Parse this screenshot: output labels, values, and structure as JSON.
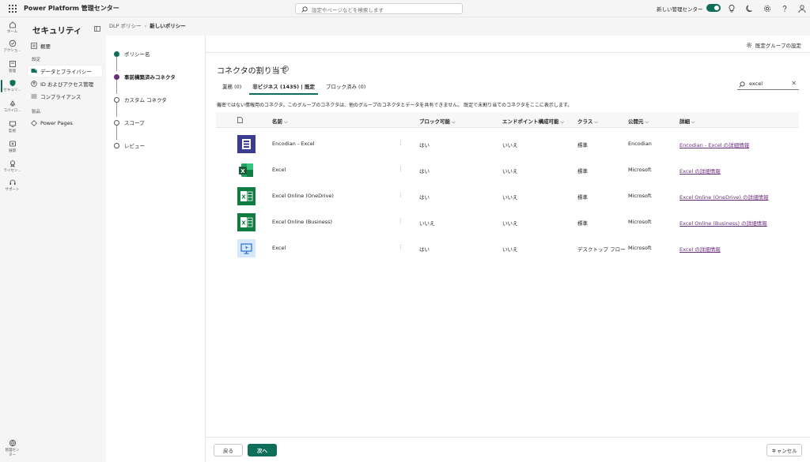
{
  "app": {
    "title": "Power Platform 管理センター"
  },
  "search": {
    "placeholder": "設定やページなどを検索します"
  },
  "header": {
    "new_admin_label": "新しい管理センター",
    "new_admin_on": true
  },
  "rail": {
    "items": [
      {
        "label": "ホーム",
        "icon": "home-icon"
      },
      {
        "label": "アクショ...",
        "icon": "actions-icon"
      },
      {
        "label": "管理",
        "icon": "manage-icon"
      },
      {
        "label": "セキュリ...",
        "icon": "shield-icon",
        "active": true
      },
      {
        "label": "コパイロ...",
        "icon": "copilot-icon"
      },
      {
        "label": "監視",
        "icon": "monitor-icon"
      },
      {
        "label": "展開",
        "icon": "deploy-icon"
      },
      {
        "label": "ライセン...",
        "icon": "license-icon"
      },
      {
        "label": "サポート",
        "icon": "support-icon"
      },
      {
        "label": "管理セン\nター",
        "icon": "admin-center-icon"
      }
    ]
  },
  "nav": {
    "title": "セキュリティ",
    "overview": "概要",
    "settings_section": "設定",
    "items": [
      {
        "label": "データとプライバシー",
        "active": true
      },
      {
        "label": "ID およびアクセス管理"
      },
      {
        "label": "コンプライアンス"
      }
    ],
    "products_section": "製品",
    "product_items": [
      {
        "label": "Power Pages"
      }
    ]
  },
  "breadcrumb": {
    "parent": "DLP ポリシー",
    "current": "新しいポリシー"
  },
  "wizard": {
    "steps": [
      {
        "label": "ポリシー名",
        "state": "done"
      },
      {
        "label": "事前構築済みコネクタ",
        "state": "current"
      },
      {
        "label": "カスタム コネクタ",
        "state": "todo"
      },
      {
        "label": "スコープ",
        "state": "todo"
      },
      {
        "label": "レビュー",
        "state": "todo"
      }
    ]
  },
  "main": {
    "default_group_label": "既定グループの設定",
    "title": "コネクタの割り当て",
    "tabs": [
      {
        "label": "業務 (0)"
      },
      {
        "label": "非ビジネス (1435) | 既定",
        "active": true
      },
      {
        "label": "ブロック済み (0)"
      }
    ],
    "filter_value": "excel",
    "description": "機密ではない情報用のコネクタ。このグループのコネクタは、他のグループのコネクタとデータを共有できません。 既定で未割り当てのコネクタをここに表示します。"
  },
  "table": {
    "headers": {
      "name": "名前",
      "blockable": "ブロック可能",
      "endpoint": "エンドポイント構成可能",
      "class": "クラス",
      "publisher": "公開元",
      "details": "詳細"
    },
    "rows": [
      {
        "name": "Encodian - Excel",
        "blockable": "はい",
        "endpoint": "いいえ",
        "class": "標準",
        "publisher": "Encodian",
        "details": "Encodian - Excel の詳細情報",
        "icon": "encodian-logo"
      },
      {
        "name": "Excel",
        "blockable": "はい",
        "endpoint": "いいえ",
        "class": "標準",
        "publisher": "Microsoft",
        "details": "Excel の詳細情報",
        "icon": "excel-logo"
      },
      {
        "name": "Excel Online (OneDrive)",
        "blockable": "はい",
        "endpoint": "いいえ",
        "class": "標準",
        "publisher": "Microsoft",
        "details": "Excel Online (OneDrive) の詳細情報",
        "icon": "excel-online-logo"
      },
      {
        "name": "Excel Online (Business)",
        "blockable": "いいえ",
        "endpoint": "いいえ",
        "class": "標準",
        "publisher": "Microsoft",
        "details": "Excel Online (Business) の詳細情報",
        "icon": "excel-online-logo"
      },
      {
        "name": "Excel",
        "blockable": "はい",
        "endpoint": "いいえ",
        "class": "デスクトップ フロー",
        "publisher": "Microsoft",
        "details": "Excel の詳細情報",
        "icon": "desktop-flow-logo"
      }
    ]
  },
  "footer": {
    "back": "戻る",
    "next": "次へ",
    "cancel": "キャンセル"
  },
  "colors": {
    "accent": "#0f6e5a",
    "current_step": "#6b2e7a",
    "link": "#6b2e7a"
  }
}
